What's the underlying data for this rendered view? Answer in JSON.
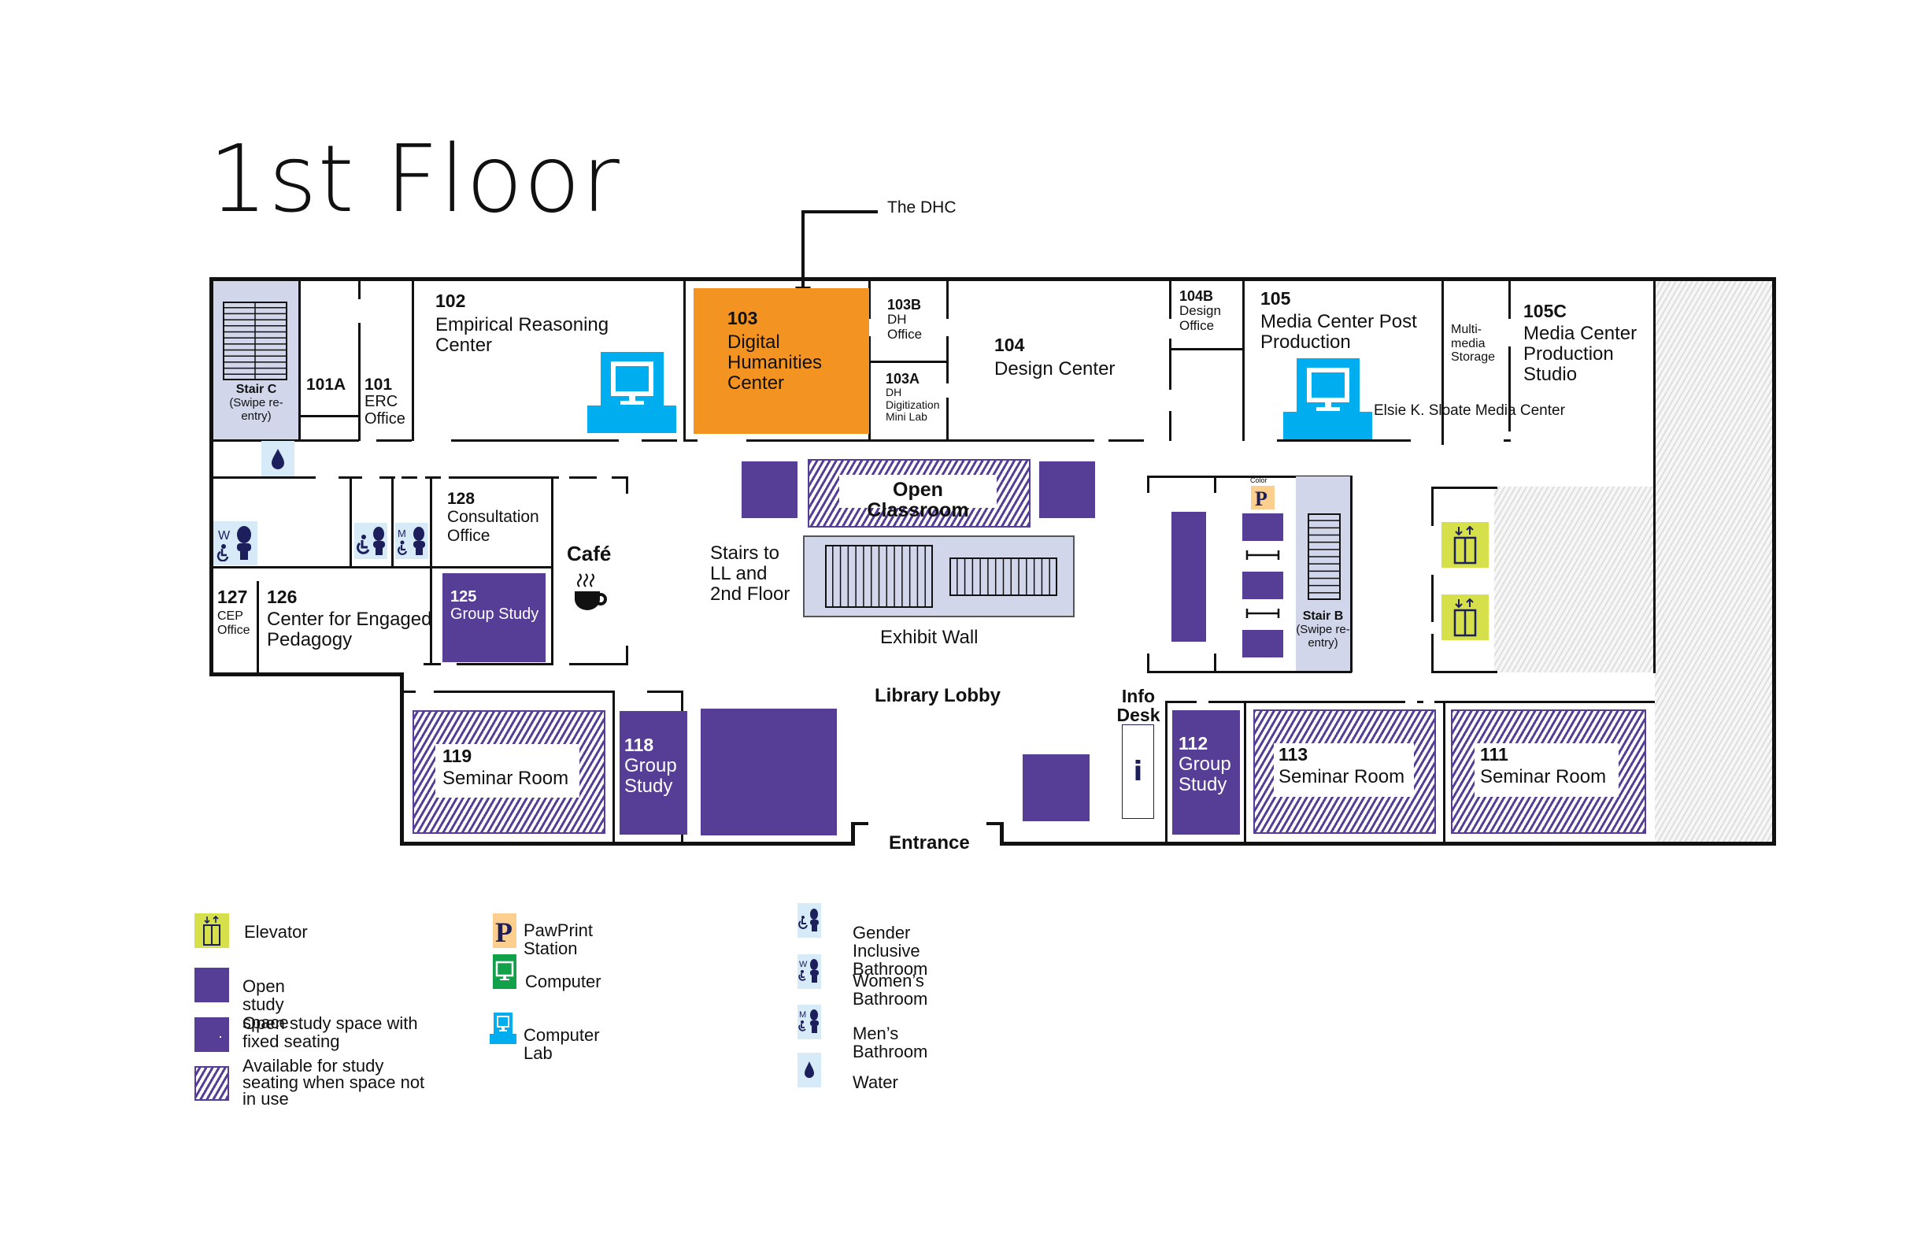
{
  "title": "1st Floor",
  "callout": {
    "label": "The DHC"
  },
  "colors": {
    "study_purple": "#563d96",
    "dhc_orange": "#f39322",
    "computer_lab_blue": "#00aeef",
    "computer_green": "#12a14b",
    "elevator_yellow": "#d5e04a",
    "pawprint_tan": "#fccf8f",
    "stair_lavender": "#d1d6eb",
    "restroom_lightblue": "#d6eaf8",
    "icon_navy": "#1d1f5c"
  },
  "rooms": {
    "stair_c": {
      "name": "Stair C",
      "note": "(Swipe re-entry)"
    },
    "r101a": {
      "number": "101A"
    },
    "r101": {
      "number": "101",
      "name": "ERC Office"
    },
    "r102": {
      "number": "102",
      "name": "Empirical Reasoning Center"
    },
    "r103": {
      "number": "103",
      "name": "Digital Humanities Center"
    },
    "r103b": {
      "number": "103B",
      "name": "DH Office"
    },
    "r103a": {
      "number": "103A",
      "name": "DH Digitization Mini Lab"
    },
    "r104": {
      "number": "104",
      "name": "Design Center"
    },
    "r104b": {
      "number": "104B",
      "name": "Design Office"
    },
    "r105": {
      "number": "105",
      "name": "Media Center Post Production"
    },
    "multimedia": {
      "name": "Multi-media Storage"
    },
    "r105c": {
      "number": "105C",
      "name": "Media Center Production Studio"
    },
    "sloate": {
      "name": "Elsie K. Sloate Media Center"
    },
    "r128": {
      "number": "128",
      "name": "Consultation Office"
    },
    "cafe": {
      "name": "Café"
    },
    "r127": {
      "number": "127",
      "name": "CEP Office"
    },
    "r126": {
      "number": "126",
      "name": "Center for Engaged Pedagogy"
    },
    "r125": {
      "number": "125",
      "name": "Group Study"
    },
    "open_classroom": {
      "name": "Open Classroom"
    },
    "stairs_main": {
      "name": "Stairs to LL and 2nd Floor"
    },
    "exhibit_wall": {
      "name": "Exhibit Wall"
    },
    "pawprint_color": {
      "name": "Color"
    },
    "stair_b": {
      "name": "Stair B",
      "note": "(Swipe re-entry)"
    },
    "library_lobby": {
      "name": "Library Lobby"
    },
    "entrance": {
      "name": "Entrance"
    },
    "info_desk": {
      "name": "Info Desk",
      "glyph": "i"
    },
    "r119": {
      "number": "119",
      "name": "Seminar Room"
    },
    "r118": {
      "number": "118",
      "name": "Group Study"
    },
    "r112": {
      "number": "112",
      "name": "Group Study"
    },
    "r113": {
      "number": "113",
      "name": "Seminar Room"
    },
    "r111": {
      "number": "111",
      "name": "Seminar Room"
    }
  },
  "restrooms": {
    "womens_letter": "W",
    "mens_letter": "M"
  },
  "legend": {
    "col1": [
      {
        "icon": "elevator-icon",
        "label": "Elevator"
      },
      {
        "icon": "open-study-swatch",
        "label": "Open study space"
      },
      {
        "icon": "fixed-seating-swatch",
        "label": "Open study space with fixed seating"
      },
      {
        "icon": "hatched-swatch",
        "label": "Available for study seating when space not in use"
      }
    ],
    "col2": [
      {
        "icon": "pawprint-icon",
        "label": "PawPrint Station"
      },
      {
        "icon": "computer-icon",
        "label": "Computer"
      },
      {
        "icon": "computer-lab-icon",
        "label": "Computer Lab"
      }
    ],
    "col3": [
      {
        "icon": "gender-inclusive-bathroom-icon",
        "label": "Gender Inclusive Bathroom"
      },
      {
        "icon": "womens-bathroom-icon",
        "label": "Women’s Bathroom"
      },
      {
        "icon": "mens-bathroom-icon",
        "label": "Men’s Bathroom"
      },
      {
        "icon": "water-icon",
        "label": "Water"
      }
    ]
  }
}
